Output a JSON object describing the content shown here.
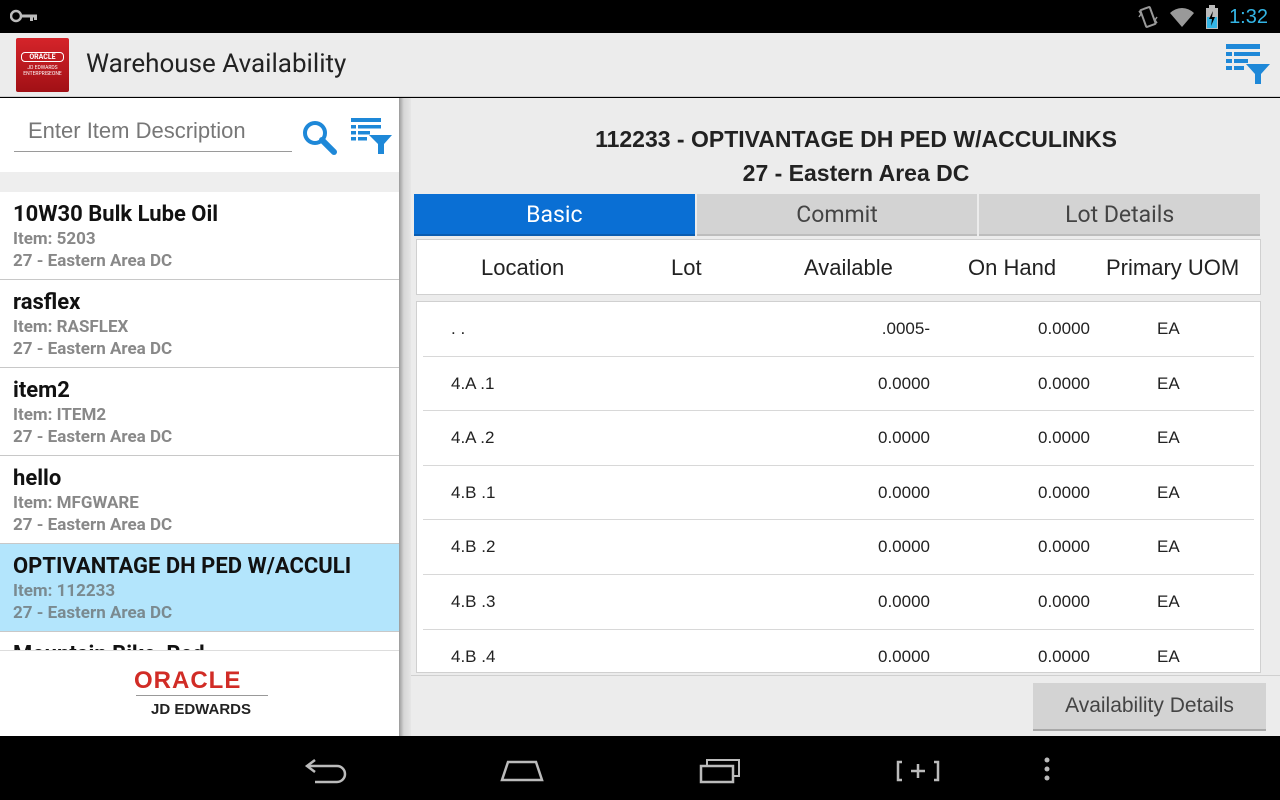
{
  "status_bar": {
    "time": "1:32"
  },
  "app": {
    "title": "Warehouse Availability",
    "logo_line1": "ORACLE",
    "logo_line2": "JD EDWARDS ENTERPRISEONE"
  },
  "search": {
    "placeholder": "Enter Item Description"
  },
  "items": [
    {
      "name": "10W30 Bulk Lube Oil",
      "item": "Item: 5203",
      "branch": "27 - Eastern Area DC",
      "selected": false
    },
    {
      "name": "rasflex",
      "item": "Item: RASFLEX",
      "branch": "27 - Eastern Area DC",
      "selected": false
    },
    {
      "name": "item2",
      "item": "Item: ITEM2",
      "branch": "27 - Eastern Area DC",
      "selected": false
    },
    {
      "name": "hello",
      "item": "Item: MFGWARE",
      "branch": "27 - Eastern Area DC",
      "selected": false
    },
    {
      "name": "OPTIVANTAGE DH PED W/ACCULI",
      "item": "Item: 112233",
      "branch": "27 - Eastern Area DC",
      "selected": true
    },
    {
      "name": "Mountain Bike, Red",
      "item": "",
      "branch": "",
      "selected": false
    }
  ],
  "brand": {
    "oracle": "ORACLE",
    "jde": "JD EDWARDS"
  },
  "detail": {
    "title_line1": "112233 - OPTIVANTAGE DH PED W/ACCULINKS",
    "title_line2": "27 - Eastern Area DC",
    "tabs": [
      "Basic",
      "Commit",
      "Lot Details"
    ],
    "active_tab": "Basic",
    "columns": [
      "Location",
      "Lot",
      "Available",
      "On Hand",
      "Primary UOM"
    ],
    "rows": [
      {
        "location": ". .",
        "lot": "",
        "available": ".0005-",
        "on_hand": "0.0000",
        "uom": "EA"
      },
      {
        "location": "4.A .1",
        "lot": "",
        "available": "0.0000",
        "on_hand": "0.0000",
        "uom": "EA"
      },
      {
        "location": "4.A .2",
        "lot": "",
        "available": "0.0000",
        "on_hand": "0.0000",
        "uom": "EA"
      },
      {
        "location": "4.B .1",
        "lot": "",
        "available": "0.0000",
        "on_hand": "0.0000",
        "uom": "EA"
      },
      {
        "location": "4.B .2",
        "lot": "",
        "available": "0.0000",
        "on_hand": "0.0000",
        "uom": "EA"
      },
      {
        "location": "4.B .3",
        "lot": "",
        "available": "0.0000",
        "on_hand": "0.0000",
        "uom": "EA"
      },
      {
        "location": "4.B .4",
        "lot": "",
        "available": "0.0000",
        "on_hand": "0.0000",
        "uom": "EA"
      }
    ],
    "details_button": "Availability Details"
  },
  "colors": {
    "active_tab": "#0a6fd4",
    "selected_item": "#b3e5fc",
    "icon_blue": "#1e88d8",
    "clock": "#33b5e5"
  },
  "icons": [
    "key-icon",
    "vibrate-icon",
    "wifi-icon",
    "battery-icon",
    "filter-icon",
    "search-icon",
    "back-icon",
    "home-icon",
    "recents-icon",
    "screenshot-icon",
    "menu-icon"
  ]
}
